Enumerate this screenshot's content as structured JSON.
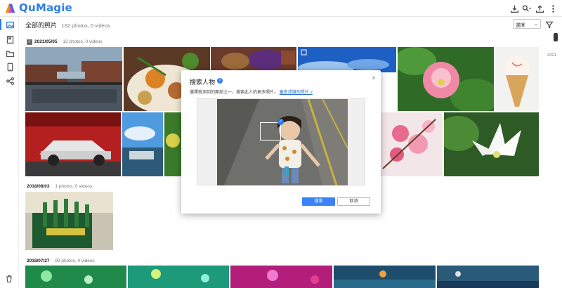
{
  "app": {
    "name": "QuMagie"
  },
  "header": {
    "icons": [
      "download-icon",
      "search-icon",
      "upload-icon",
      "more-icon"
    ]
  },
  "sidebar": {
    "items": [
      "photos-icon",
      "album-icon",
      "folder-icon",
      "device-icon",
      "share-icon"
    ],
    "bottom": "trash-icon"
  },
  "toolbar": {
    "title": "全部的照片",
    "count": "162 photos, 0 videos",
    "sort_label": "選擇",
    "year": "2021"
  },
  "sections": [
    {
      "date": "2021/05/05",
      "count": "13 photos, 0 videos"
    },
    {
      "date": "2018/08/03",
      "count": "1 photos, 0 videos"
    },
    {
      "date": "2018/07/27",
      "count": "93 photos, 0 videos"
    }
  ],
  "modal": {
    "title": "搜索人物",
    "description": "選擇檢測到的面部之一，搜索此人的更多照片。",
    "link": "審查或識別照片 >",
    "search_button": "搜索",
    "cancel_button": "取消",
    "close": "×"
  }
}
